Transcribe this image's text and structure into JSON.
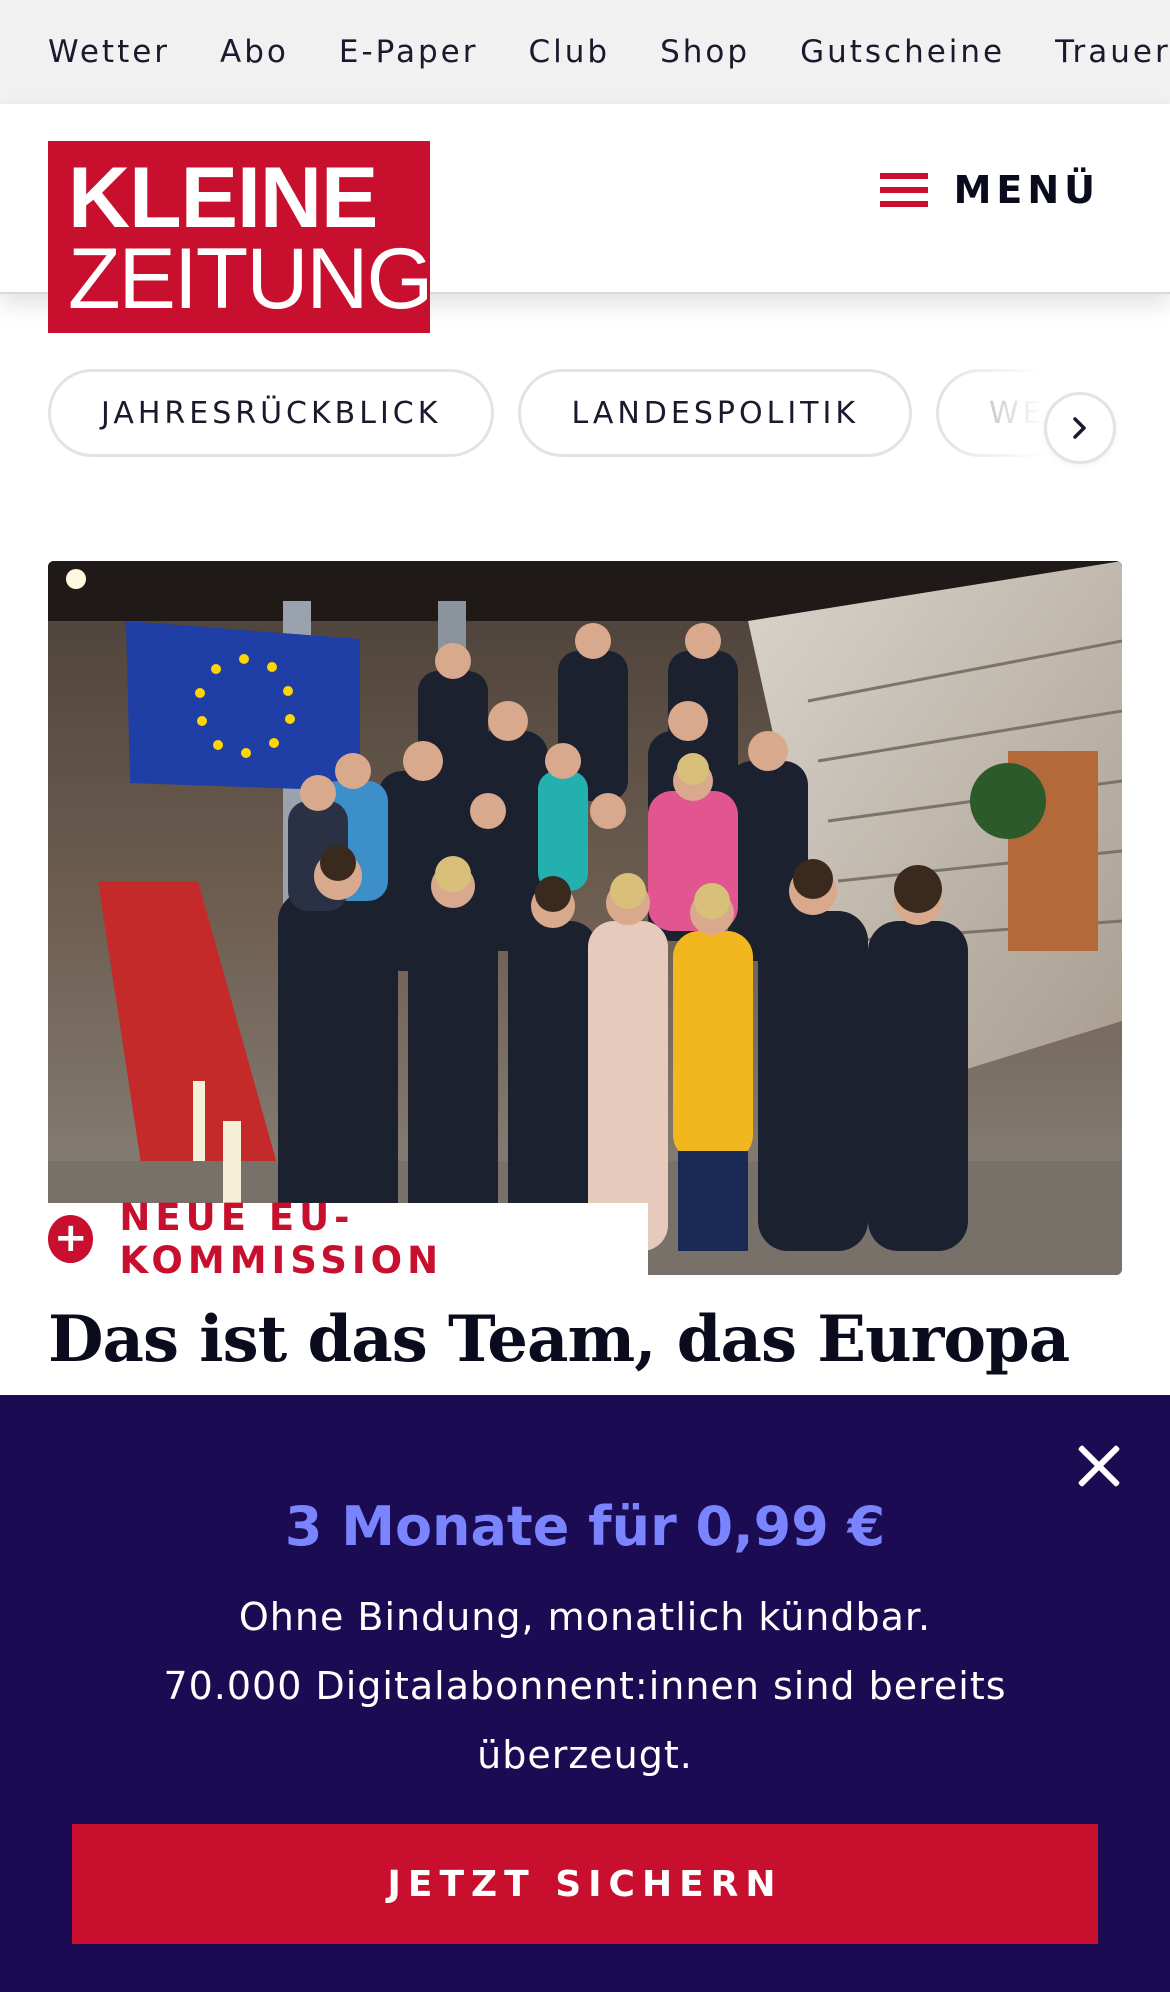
{
  "topnav": {
    "items": [
      "Wetter",
      "Abo",
      "E-Paper",
      "Club",
      "Shop",
      "Gutscheine",
      "Trauerportal"
    ]
  },
  "header": {
    "logo_line1": "KLEINE",
    "logo_line2": "ZEITUNG",
    "menu_label": "MENÜ"
  },
  "pills": {
    "items": [
      "JAHRESRÜCKBLICK",
      "LANDESPOLITIK",
      "WE"
    ]
  },
  "article": {
    "kicker": "NEUE EU-KOMMISSION",
    "headline": "Das ist das Team, das Europa"
  },
  "paywall": {
    "offer": "3 Monate für 0,99 €",
    "line1": "Ohne Bindung, monatlich kündbar.",
    "line2": "70.000 Digitalabonnent:innen sind bereits",
    "line3": "überzeugt.",
    "cta": "JETZT SICHERN"
  },
  "colors": {
    "brand_red": "#c8102e",
    "overlay_bg": "#1b0b52",
    "offer_accent": "#7b84ff"
  },
  "icons": {
    "menu": "hamburger-icon",
    "pills_next": "chevron-right-icon",
    "kicker": "plus-circle-icon",
    "close": "close-icon"
  }
}
